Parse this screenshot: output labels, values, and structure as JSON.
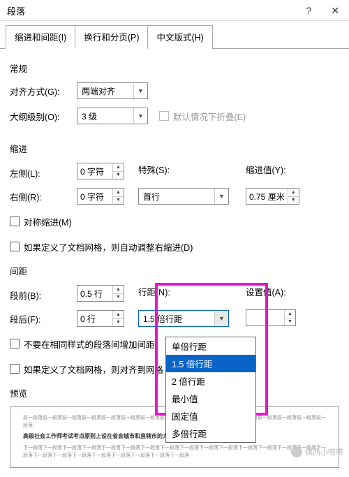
{
  "title": "段落",
  "win": {
    "help": "?",
    "close": "✕"
  },
  "tabs": [
    "缩进和间距(I)",
    "换行和分页(P)",
    "中文版式(H)"
  ],
  "active_tab": 0,
  "sections": {
    "general": "常规",
    "indent": "缩进",
    "spacing": "间距",
    "preview": "预览"
  },
  "general": {
    "align_label": "对齐方式(G):",
    "align_value": "两端对齐",
    "outline_label": "大纲级别(O):",
    "outline_value": "3 级",
    "collapse_label": "默认情况下折叠(E)"
  },
  "indent": {
    "left_label": "左侧(L):",
    "left_value": "0 字符",
    "right_label": "右侧(R):",
    "right_value": "0 字符",
    "special_label": "特殊(S):",
    "special_value": "首行",
    "indval_label": "缩进值(Y):",
    "indval_value": "0.75 厘米",
    "mirror_label": "对称缩进(M)",
    "grid_label": "如果定义了文档网格，则自动调整右缩进(D)"
  },
  "spacing": {
    "before_label": "段前(B):",
    "before_value": "0.5 行",
    "after_label": "段后(F):",
    "after_value": "0 行",
    "line_label": "行距(N):",
    "line_value": "1.5 倍行距",
    "setval_label": "设置值(A):",
    "setval_value": "",
    "nosame_label": "不要在相同样式的段落间增加间距",
    "grid_label": "如果定义了文档网格，则对齐到网格"
  },
  "line_options": [
    "单倍行距",
    "1.5 倍行距",
    "2 倍行距",
    "最小值",
    "固定值",
    "多倍行距"
  ],
  "line_selected": "1.5 倍行距",
  "preview_filler": "前一段落前一段落前一段落前一段落前一段落前一段落前一段落前一段落前一段落前一段落前一段落前一段落前一段落前一段落前一段落前一段落",
  "preview_bold": "高级社会工作师考试考点原则上设在省会城市和直辖市的大、中专院校或高考定点学校。",
  "preview_after": "下一段落下一段落下一段落下一段落下一段落下一段落下一段落下一段落下一段落下一段落下一段落下一段落下一段落下一段落下一段落下一段落下一段落下一段落下一段落下一段落下一段落下一段落下一段落下一段落",
  "watermark": "偶西小嗒嗒"
}
